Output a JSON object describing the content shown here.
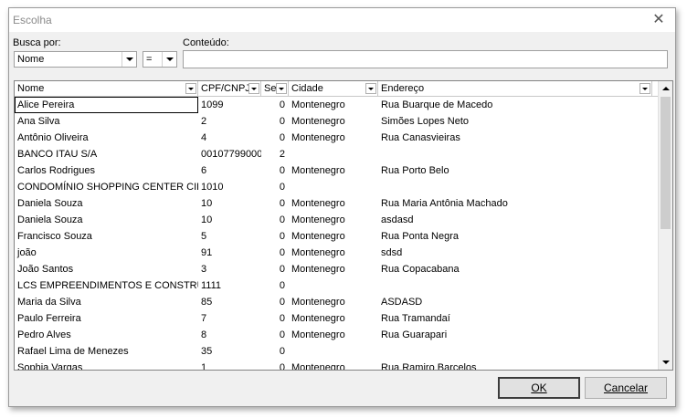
{
  "window": {
    "title": "Escolha"
  },
  "search": {
    "by_label": "Busca por:",
    "content_label": "Conteúdo:",
    "field_value": "Nome",
    "operator_value": "=",
    "content_value": ""
  },
  "grid": {
    "columns": [
      "Nome",
      "CPF/CNPJ",
      "Se",
      "Cidade",
      "Endereço"
    ],
    "rows": [
      [
        "Alice Pereira",
        "1099",
        "0",
        "Montenegro",
        "Rua Buarque de Macedo"
      ],
      [
        "Ana Silva",
        "2",
        "0",
        "Montenegro",
        "Simões Lopes Neto"
      ],
      [
        "Antônio Oliveira",
        "4",
        "0",
        "Montenegro",
        "Rua Canasvieiras"
      ],
      [
        "BANCO ITAU S/A",
        "00107799000",
        "2",
        "",
        ""
      ],
      [
        "Carlos Rodrigues",
        "6",
        "0",
        "Montenegro",
        "Rua Porto Belo"
      ],
      [
        "CONDOMÍNIO SHOPPING CENTER CIDADE",
        "1010",
        "0",
        "",
        ""
      ],
      [
        "Daniela Souza",
        "10",
        "0",
        "Montenegro",
        "Rua Maria Antônia Machado"
      ],
      [
        "Daniela Souza",
        "10",
        "0",
        "Montenegro",
        "asdasd"
      ],
      [
        "Francisco Souza",
        "5",
        "0",
        "Montenegro",
        "Rua Ponta Negra"
      ],
      [
        "joão",
        "91",
        "0",
        "Montenegro",
        "sdsd"
      ],
      [
        "João Santos",
        "3",
        "0",
        "Montenegro",
        "Rua Copacabana"
      ],
      [
        "LCS EMPREENDIMENTOS E CONSTRUÇÕES",
        "1111",
        "0",
        "",
        ""
      ],
      [
        "Maria da Silva",
        "85",
        "0",
        "Montenegro",
        "ASDASD"
      ],
      [
        "Paulo Ferreira",
        "7",
        "0",
        "Montenegro",
        "Rua Tramandaí"
      ],
      [
        "Pedro Alves",
        "8",
        "0",
        "Montenegro",
        "Rua Guarapari"
      ],
      [
        "Rafael Lima de Menezes",
        "35",
        "0",
        "",
        ""
      ],
      [
        "Sophia Vargas",
        "1",
        "0",
        "Montenegro",
        "Rua Ramiro Barcelos"
      ]
    ]
  },
  "buttons": {
    "ok": "OK",
    "cancel": "Cancelar"
  },
  "colors": {
    "dialog_bg": "#f0f0f0",
    "grid_bg": "#ffffff",
    "border": "#828282"
  }
}
